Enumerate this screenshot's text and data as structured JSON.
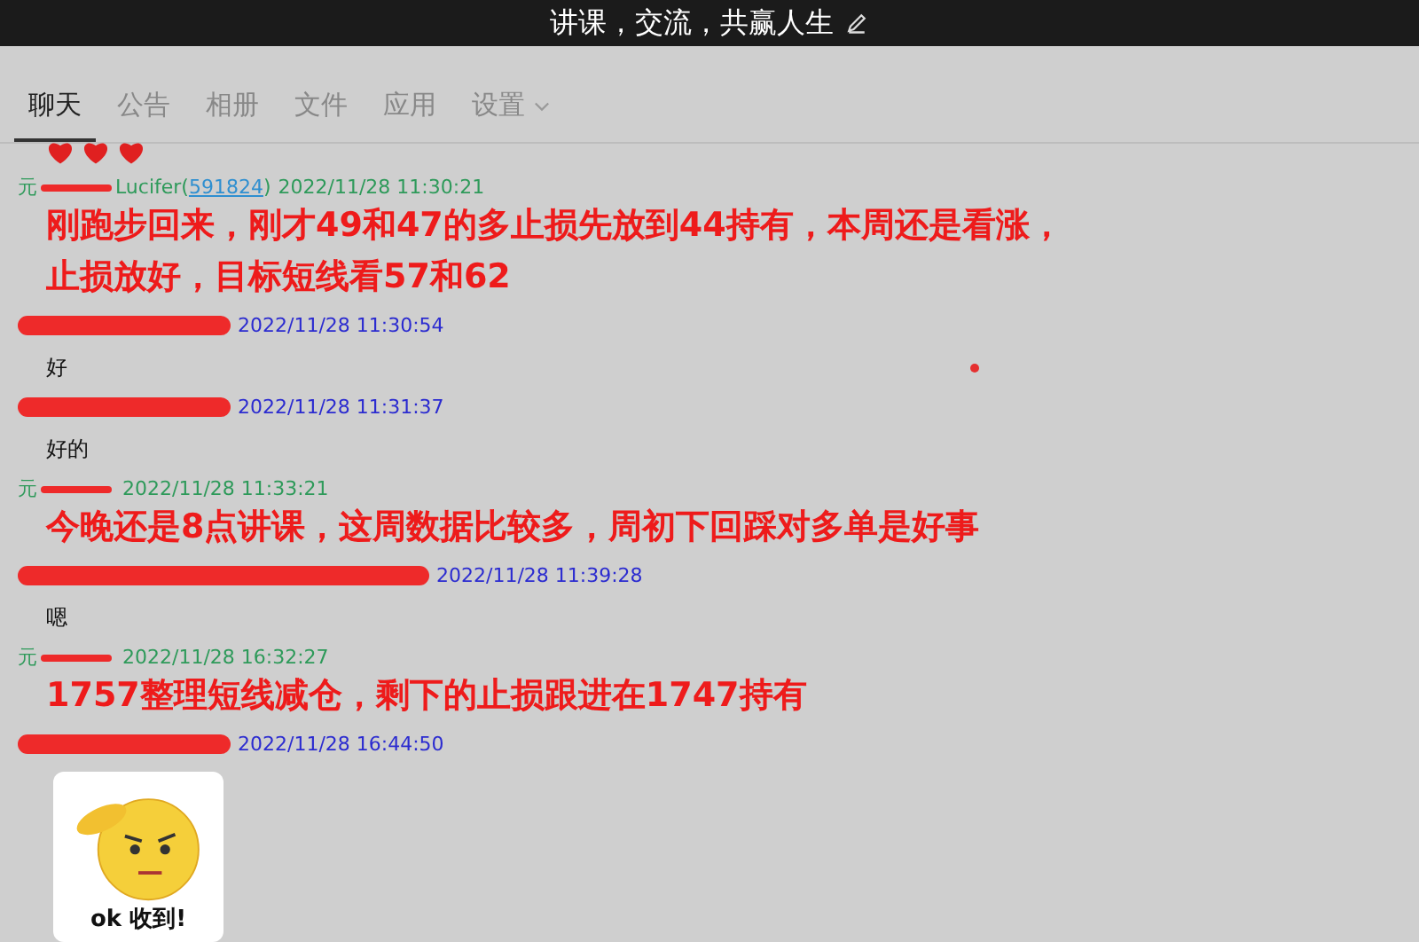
{
  "window": {
    "title": "讲课，交流，共赢人生"
  },
  "tabs": [
    {
      "label": "聊天",
      "selected": true
    },
    {
      "label": "公告",
      "selected": false
    },
    {
      "label": "相册",
      "selected": false
    },
    {
      "label": "文件",
      "selected": false
    },
    {
      "label": "应用",
      "selected": false
    },
    {
      "label": "设置",
      "selected": false,
      "dropdown": true
    }
  ],
  "messages": [
    {
      "sender": {
        "kind": "admin",
        "prefix": "元",
        "redacted": true,
        "name": "Lucifer(",
        "id": "591824",
        ")": ")"
      },
      "time": "2022/11/28 11:30:21",
      "kind": "highlight",
      "lines": [
        "刚跑步回来，刚才49和47的多止损先放到44持有，本周还是看涨，",
        "止损放好，目标短线看57和62"
      ]
    },
    {
      "sender": {
        "kind": "member",
        "redacted": true
      },
      "time": "2022/11/28 11:30:54",
      "kind": "plain",
      "lines": [
        "好"
      ]
    },
    {
      "sender": {
        "kind": "member",
        "redacted": true
      },
      "time": "2022/11/28 11:31:37",
      "kind": "plain",
      "lines": [
        "好的"
      ]
    },
    {
      "sender": {
        "kind": "admin",
        "prefix": "元",
        "redacted": true
      },
      "time": "2022/11/28 11:33:21",
      "kind": "highlight",
      "lines": [
        "今晚还是8点讲课，这周数据比较多，周初下回踩对多单是好事"
      ]
    },
    {
      "sender": {
        "kind": "member",
        "redacted": true,
        "wide": true
      },
      "time": "2022/11/28 11:39:28",
      "kind": "plain",
      "lines": [
        "嗯"
      ]
    },
    {
      "sender": {
        "kind": "admin",
        "prefix": "元",
        "redacted": true
      },
      "time": "2022/11/28 16:32:27",
      "kind": "highlight",
      "lines": [
        "1757整理短线减仓，剩下的止损跟进在1747持有"
      ]
    },
    {
      "sender": {
        "kind": "member",
        "redacted": true
      },
      "time": "2022/11/28 16:44:50",
      "kind": "sticker",
      "caption": "ok 收到!"
    }
  ]
}
